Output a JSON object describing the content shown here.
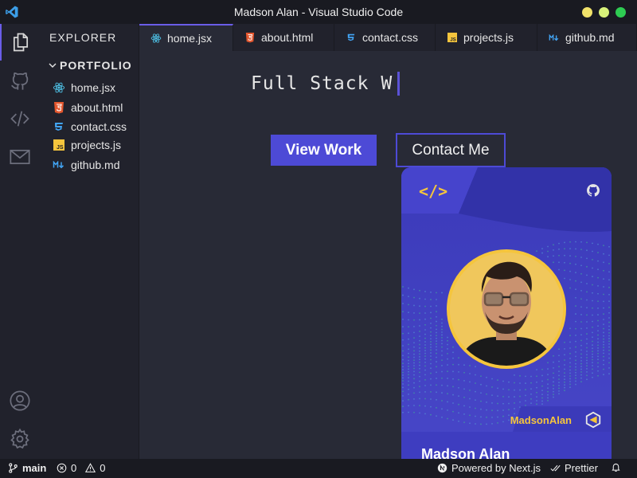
{
  "window": {
    "title": "Madson Alan - Visual Studio Code"
  },
  "colors": {
    "accent": "#4d4ad6",
    "gold": "#f5c53d",
    "close": "#2ecc52",
    "max": "#f1e26a",
    "min": "#d8f27a"
  },
  "sidebar": {
    "header": "EXPLORER",
    "folder": "PORTFOLIO",
    "files": [
      {
        "label": "home.jsx",
        "icon": "react-icon"
      },
      {
        "label": "about.html",
        "icon": "html-icon"
      },
      {
        "label": "contact.css",
        "icon": "css-icon"
      },
      {
        "label": "projects.js",
        "icon": "js-icon"
      },
      {
        "label": "github.md",
        "icon": "markdown-icon"
      }
    ]
  },
  "tabs": [
    {
      "label": "home.jsx",
      "icon": "react-icon",
      "active": true
    },
    {
      "label": "about.html",
      "icon": "html-icon"
    },
    {
      "label": "contact.css",
      "icon": "css-icon"
    },
    {
      "label": "projects.js",
      "icon": "js-icon"
    },
    {
      "label": "github.md",
      "icon": "markdown-icon"
    }
  ],
  "editor": {
    "typed_text": "Full Stack W",
    "primary_button": "View Work",
    "secondary_button": "Contact Me"
  },
  "card": {
    "code_symbol": "</>",
    "handle": "MadsonAlan",
    "name": "Madson Alan"
  },
  "statusbar": {
    "branch": "main",
    "errors": "0",
    "warnings": "0",
    "powered": "Powered by Next.js",
    "prettier": "Prettier"
  }
}
